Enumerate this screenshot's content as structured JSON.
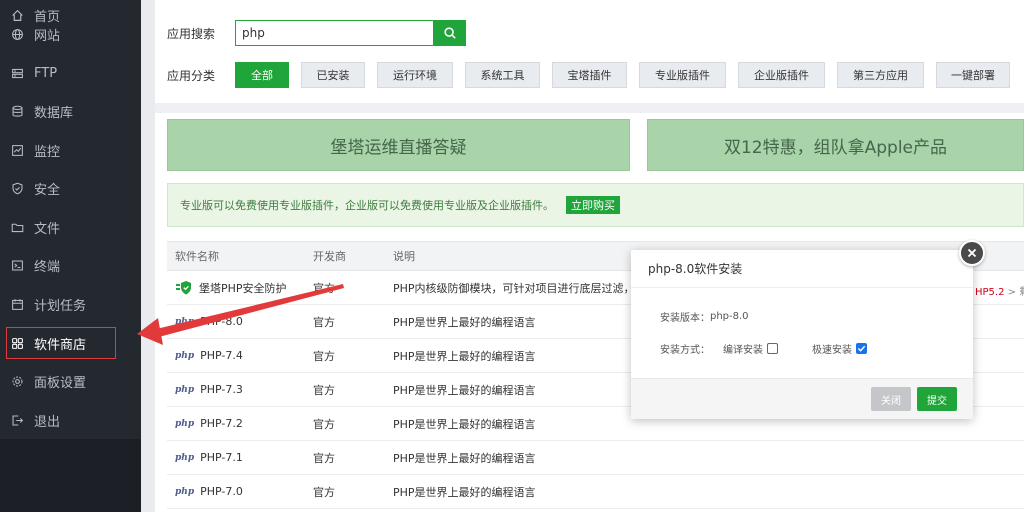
{
  "sidebar": {
    "items": [
      {
        "label": "首页",
        "icon": "home-icon"
      },
      {
        "label": "网站",
        "icon": "globe-icon"
      },
      {
        "label": "FTP",
        "icon": "ftp-icon"
      },
      {
        "label": "数据库",
        "icon": "database-icon"
      },
      {
        "label": "监控",
        "icon": "monitor-icon"
      },
      {
        "label": "安全",
        "icon": "shield-icon"
      },
      {
        "label": "文件",
        "icon": "folder-icon"
      },
      {
        "label": "终端",
        "icon": "terminal-icon"
      },
      {
        "label": "计划任务",
        "icon": "calendar-icon"
      },
      {
        "label": "软件商店",
        "icon": "grid-icon"
      },
      {
        "label": "面板设置",
        "icon": "gear-icon"
      },
      {
        "label": "退出",
        "icon": "logout-icon"
      }
    ],
    "active_index": 9,
    "colors": {
      "bg": "#24282f",
      "text": "#b8bcc3",
      "highlight_box": "#e23a3a"
    }
  },
  "search": {
    "label": "应用搜索",
    "value": "php"
  },
  "categories": {
    "label": "应用分类",
    "items": [
      "全部",
      "已安装",
      "运行环境",
      "系统工具",
      "宝塔插件",
      "专业版插件",
      "企业版插件",
      "第三方应用",
      "一键部署"
    ],
    "active_index": 0
  },
  "banners": [
    "堡塔运维直播答疑",
    "双12特惠，组队拿Apple产品"
  ],
  "notice": {
    "text": "专业版可以免费使用专业版插件，企业版可以免费使用专业版及企业版插件。",
    "button": "立即购买"
  },
  "table": {
    "headers": [
      "软件名称",
      "开发商",
      "说明"
    ],
    "rows": [
      {
        "name": "堡塔PHP安全防护",
        "vendor": "官方",
        "desc": "PHP内核级防御模块，可针对项目进行底层过滤，彻",
        "logo": "shield-plugin-icon"
      },
      {
        "name": "PHP-8.0",
        "vendor": "官方",
        "desc": "PHP是世界上最好的编程语言",
        "logo": "php"
      },
      {
        "name": "PHP-7.4",
        "vendor": "官方",
        "desc": "PHP是世界上最好的编程语言",
        "logo": "php"
      },
      {
        "name": "PHP-7.3",
        "vendor": "官方",
        "desc": "PHP是世界上最好的编程语言",
        "logo": "php"
      },
      {
        "name": "PHP-7.2",
        "vendor": "官方",
        "desc": "PHP是世界上最好的编程语言",
        "logo": "php"
      },
      {
        "name": "PHP-7.1",
        "vendor": "官方",
        "desc": "PHP是世界上最好的编程语言",
        "logo": "php"
      },
      {
        "name": "PHP-7.0",
        "vendor": "官方",
        "desc": "PHP是世界上最好的编程语言",
        "logo": "php"
      }
    ],
    "php_logo_text": "php",
    "row0_extra": "HP5.2",
    "row0_extra_tail": "> 剩"
  },
  "modal": {
    "title": "php-8.0软件安装",
    "version_label": "安装版本：",
    "version_value": "php-8.0",
    "method_label": "安装方式：",
    "option_compile": "编译安装",
    "option_compile_checked": false,
    "option_fast": "极速安装",
    "option_fast_checked": true,
    "close_button": "关闭",
    "submit_button": "提交"
  },
  "colors": {
    "accent": "#20a53a",
    "banner": "#a9d3a8",
    "annotation": "#e23a3a"
  }
}
